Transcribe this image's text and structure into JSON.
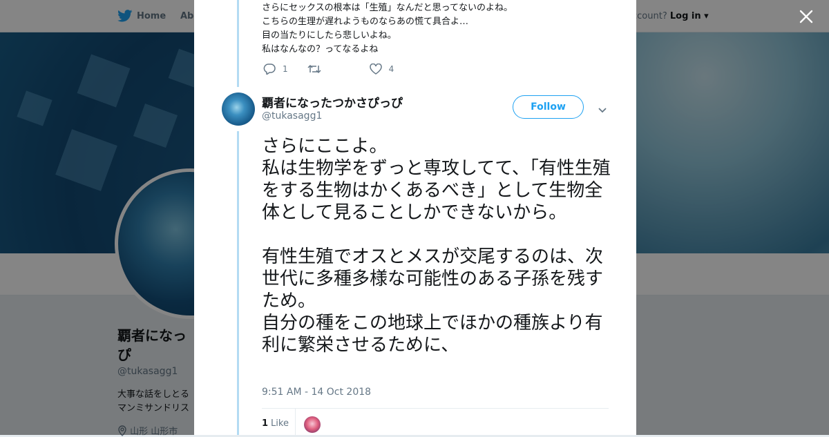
{
  "nav": {
    "home_label": "Home",
    "about_label": "Abo",
    "account_prefix": "ccount?",
    "login_label": "Log in"
  },
  "profile": {
    "name": "覇者になっ\nぴ",
    "handle": "@tukasagg1",
    "bio_line1": "大事な話をしとる",
    "bio_line2": "マンミサンドリス",
    "location": "山形 山形市"
  },
  "prev_tweet": {
    "lines": [
      "さらにセックスの根本は「生殖」なんだと思ってないのよね。",
      "こちらの生理が遅れようものならあの慌て具合よ…",
      "目の当たりにしたら悲しいよね。",
      "私はなんなの？ってなるよね"
    ],
    "reply_count": "1",
    "retweet_count": "",
    "like_count": "4"
  },
  "tweet": {
    "display_name": "覇者になったつかさぴっぴ",
    "handle": "@tukasagg1",
    "follow_label": "Follow",
    "text": "さらにここよ。\n私は生物学をずっと専攻してて、「有性生殖をする生物はかくあるべき」として生物全体として見ることしかできないから。\n\n有性生殖でオスとメスが交尾するのは、次世代に多種多様な可能性のある子孫を残すため。\n自分の種をこの地球上でほかの種族より有利に繁栄させるために、",
    "timestamp": "9:51 AM - 14 Oct 2018",
    "like_count": "1",
    "like_label": "Like"
  },
  "icons": {
    "close": "close-icon",
    "bird": "twitter-bird-icon",
    "reply": "reply-icon",
    "retweet": "retweet-icon",
    "like": "heart-icon",
    "chevron": "chevron-down-icon",
    "location": "location-pin-icon"
  },
  "colors": {
    "accent": "#1da1f2",
    "thread_line": "#b3dbf3",
    "text_primary": "#14171a",
    "text_secondary": "#657786"
  }
}
